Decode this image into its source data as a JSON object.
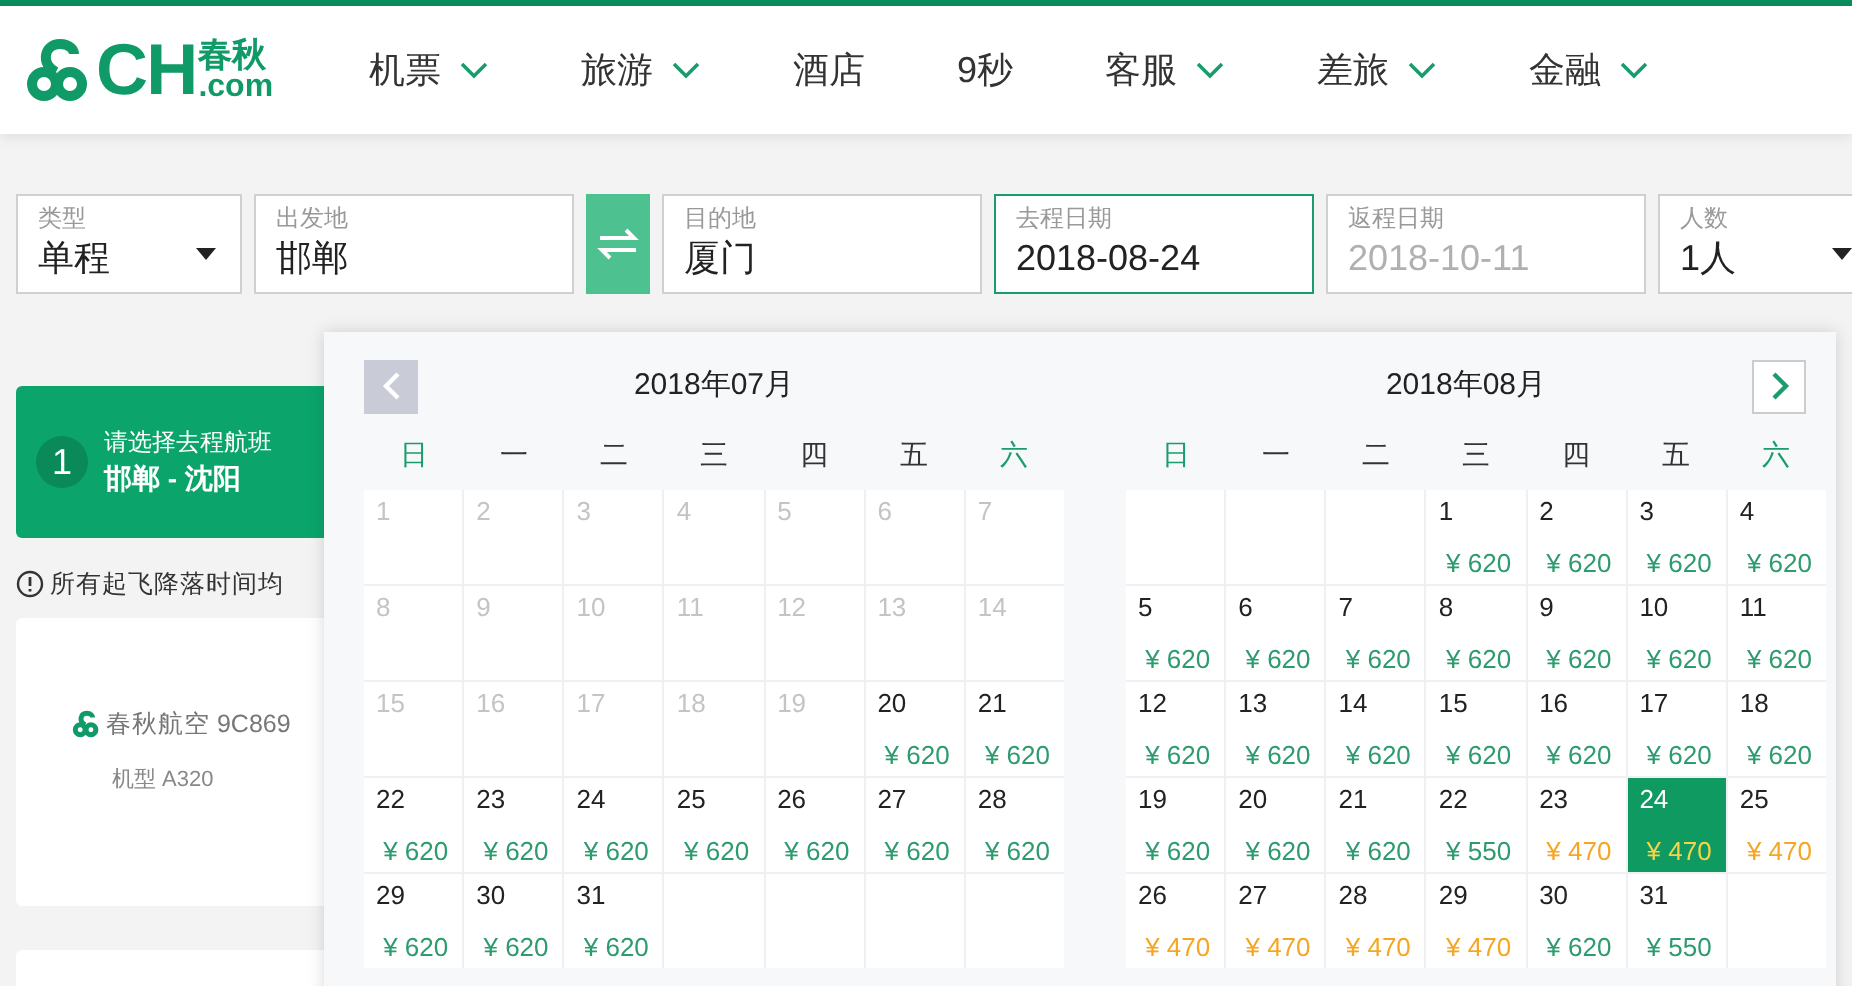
{
  "logo": {
    "letters": "CH",
    "cn": "春秋",
    "domain": ".com"
  },
  "nav": [
    {
      "label": "机票",
      "dropdown": true
    },
    {
      "label": "旅游",
      "dropdown": true
    },
    {
      "label": "酒店",
      "dropdown": false
    },
    {
      "label": "9秒",
      "dropdown": false
    },
    {
      "label": "客服",
      "dropdown": true
    },
    {
      "label": "差旅",
      "dropdown": true
    },
    {
      "label": "金融",
      "dropdown": true
    }
  ],
  "search": {
    "fields": [
      {
        "kind": "select",
        "label": "类型",
        "value": "单程",
        "active": false
      },
      {
        "kind": "text",
        "label": "出发地",
        "value": "邯郸",
        "active": false
      },
      {
        "kind": "swap"
      },
      {
        "kind": "text",
        "label": "目的地",
        "value": "厦门",
        "active": false
      },
      {
        "kind": "text",
        "label": "去程日期",
        "value": "2018-08-24",
        "active": true
      },
      {
        "kind": "placeholder",
        "label": "返程日期",
        "placeholder": "2018-10-11",
        "active": false
      },
      {
        "kind": "select",
        "label": "人数",
        "value": "1人",
        "active": false
      }
    ]
  },
  "step": {
    "number": "1",
    "title": "请选择去程航班",
    "route": "邯郸 - 沈阳"
  },
  "notice": "所有起飞降落时间均",
  "flight": {
    "airline": "春秋航空 9C869",
    "aircraft": "机型 A320"
  },
  "calendar": {
    "months": [
      {
        "title": "2018年07月",
        "weekdays": [
          {
            "label": "日",
            "weekend": true
          },
          {
            "label": "一",
            "weekend": false
          },
          {
            "label": "二",
            "weekend": false
          },
          {
            "label": "三",
            "weekend": false
          },
          {
            "label": "四",
            "weekend": false
          },
          {
            "label": "五",
            "weekend": false
          },
          {
            "label": "六",
            "weekend": true
          }
        ],
        "days": [
          {
            "kind": "past",
            "day": "1"
          },
          {
            "kind": "past",
            "day": "2"
          },
          {
            "kind": "past",
            "day": "3"
          },
          {
            "kind": "past",
            "day": "4"
          },
          {
            "kind": "past",
            "day": "5"
          },
          {
            "kind": "past",
            "day": "6"
          },
          {
            "kind": "past",
            "day": "7"
          },
          {
            "kind": "past",
            "day": "8"
          },
          {
            "kind": "past",
            "day": "9"
          },
          {
            "kind": "past",
            "day": "10"
          },
          {
            "kind": "past",
            "day": "11"
          },
          {
            "kind": "past",
            "day": "12"
          },
          {
            "kind": "past",
            "day": "13"
          },
          {
            "kind": "past",
            "day": "14"
          },
          {
            "kind": "past",
            "day": "15"
          },
          {
            "kind": "past",
            "day": "16"
          },
          {
            "kind": "past",
            "day": "17"
          },
          {
            "kind": "past",
            "day": "18"
          },
          {
            "kind": "past",
            "day": "19"
          },
          {
            "kind": "fare",
            "day": "20",
            "price": "¥ 620",
            "cheap": false,
            "selected": false
          },
          {
            "kind": "fare",
            "day": "21",
            "price": "¥ 620",
            "cheap": false,
            "selected": false
          },
          {
            "kind": "fare",
            "day": "22",
            "price": "¥ 620",
            "cheap": false,
            "selected": false
          },
          {
            "kind": "fare",
            "day": "23",
            "price": "¥ 620",
            "cheap": false,
            "selected": false
          },
          {
            "kind": "fare",
            "day": "24",
            "price": "¥ 620",
            "cheap": false,
            "selected": false
          },
          {
            "kind": "fare",
            "day": "25",
            "price": "¥ 620",
            "cheap": false,
            "selected": false
          },
          {
            "kind": "fare",
            "day": "26",
            "price": "¥ 620",
            "cheap": false,
            "selected": false
          },
          {
            "kind": "fare",
            "day": "27",
            "price": "¥ 620",
            "cheap": false,
            "selected": false
          },
          {
            "kind": "fare",
            "day": "28",
            "price": "¥ 620",
            "cheap": false,
            "selected": false
          },
          {
            "kind": "fare",
            "day": "29",
            "price": "¥ 620",
            "cheap": false,
            "selected": false
          },
          {
            "kind": "fare",
            "day": "30",
            "price": "¥ 620",
            "cheap": false,
            "selected": false
          },
          {
            "kind": "fare",
            "day": "31",
            "price": "¥ 620",
            "cheap": false,
            "selected": false
          }
        ]
      },
      {
        "title": "2018年08月",
        "weekdays": [
          {
            "label": "日",
            "weekend": true
          },
          {
            "label": "一",
            "weekend": false
          },
          {
            "label": "二",
            "weekend": false
          },
          {
            "label": "三",
            "weekend": false
          },
          {
            "label": "四",
            "weekend": false
          },
          {
            "label": "五",
            "weekend": false
          },
          {
            "label": "六",
            "weekend": true
          }
        ],
        "days": [
          {
            "kind": "blank"
          },
          {
            "kind": "blank"
          },
          {
            "kind": "blank"
          },
          {
            "kind": "fare",
            "day": "1",
            "price": "¥ 620",
            "cheap": false,
            "selected": false
          },
          {
            "kind": "fare",
            "day": "2",
            "price": "¥ 620",
            "cheap": false,
            "selected": false
          },
          {
            "kind": "fare",
            "day": "3",
            "price": "¥ 620",
            "cheap": false,
            "selected": false
          },
          {
            "kind": "fare",
            "day": "4",
            "price": "¥ 620",
            "cheap": false,
            "selected": false
          },
          {
            "kind": "fare",
            "day": "5",
            "price": "¥ 620",
            "cheap": false,
            "selected": false
          },
          {
            "kind": "fare",
            "day": "6",
            "price": "¥ 620",
            "cheap": false,
            "selected": false
          },
          {
            "kind": "fare",
            "day": "7",
            "price": "¥ 620",
            "cheap": false,
            "selected": false
          },
          {
            "kind": "fare",
            "day": "8",
            "price": "¥ 620",
            "cheap": false,
            "selected": false
          },
          {
            "kind": "fare",
            "day": "9",
            "price": "¥ 620",
            "cheap": false,
            "selected": false
          },
          {
            "kind": "fare",
            "day": "10",
            "price": "¥ 620",
            "cheap": false,
            "selected": false
          },
          {
            "kind": "fare",
            "day": "11",
            "price": "¥ 620",
            "cheap": false,
            "selected": false
          },
          {
            "kind": "fare",
            "day": "12",
            "price": "¥ 620",
            "cheap": false,
            "selected": false
          },
          {
            "kind": "fare",
            "day": "13",
            "price": "¥ 620",
            "cheap": false,
            "selected": false
          },
          {
            "kind": "fare",
            "day": "14",
            "price": "¥ 620",
            "cheap": false,
            "selected": false
          },
          {
            "kind": "fare",
            "day": "15",
            "price": "¥ 620",
            "cheap": false,
            "selected": false
          },
          {
            "kind": "fare",
            "day": "16",
            "price": "¥ 620",
            "cheap": false,
            "selected": false
          },
          {
            "kind": "fare",
            "day": "17",
            "price": "¥ 620",
            "cheap": false,
            "selected": false
          },
          {
            "kind": "fare",
            "day": "18",
            "price": "¥ 620",
            "cheap": false,
            "selected": false
          },
          {
            "kind": "fare",
            "day": "19",
            "price": "¥ 620",
            "cheap": false,
            "selected": false
          },
          {
            "kind": "fare",
            "day": "20",
            "price": "¥ 620",
            "cheap": false,
            "selected": false
          },
          {
            "kind": "fare",
            "day": "21",
            "price": "¥ 620",
            "cheap": false,
            "selected": false
          },
          {
            "kind": "fare",
            "day": "22",
            "price": "¥ 550",
            "cheap": false,
            "selected": false
          },
          {
            "kind": "fare",
            "day": "23",
            "price": "¥ 470",
            "cheap": true,
            "selected": false
          },
          {
            "kind": "fare",
            "day": "24",
            "price": "¥ 470",
            "cheap": true,
            "selected": true
          },
          {
            "kind": "fare",
            "day": "25",
            "price": "¥ 470",
            "cheap": true,
            "selected": false
          },
          {
            "kind": "fare",
            "day": "26",
            "price": "¥ 470",
            "cheap": true,
            "selected": false
          },
          {
            "kind": "fare",
            "day": "27",
            "price": "¥ 470",
            "cheap": true,
            "selected": false
          },
          {
            "kind": "fare",
            "day": "28",
            "price": "¥ 470",
            "cheap": true,
            "selected": false
          },
          {
            "kind": "fare",
            "day": "29",
            "price": "¥ 470",
            "cheap": true,
            "selected": false
          },
          {
            "kind": "fare",
            "day": "30",
            "price": "¥ 620",
            "cheap": false,
            "selected": false
          },
          {
            "kind": "fare",
            "day": "31",
            "price": "¥ 550",
            "cheap": false,
            "selected": false
          }
        ]
      }
    ]
  }
}
